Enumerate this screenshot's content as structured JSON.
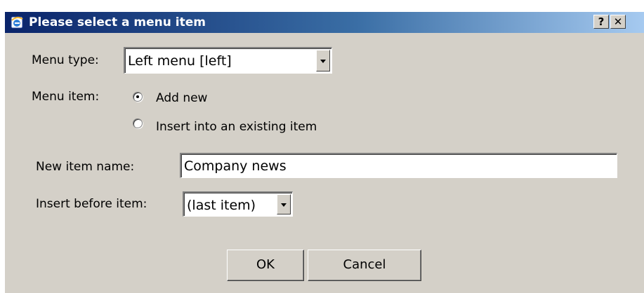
{
  "window": {
    "title": "Please select a menu item",
    "help_label": "?",
    "close_label": "✕",
    "icon": "ie-window-icon"
  },
  "form": {
    "menu_type": {
      "label": "Menu type:",
      "value": "Left menu [left]"
    },
    "menu_item": {
      "label": "Menu item:",
      "options": [
        {
          "label": "Add new",
          "checked": true
        },
        {
          "label": "Insert into an existing item",
          "checked": false
        }
      ]
    },
    "new_item_name": {
      "label": "New item name:",
      "value": "Company news"
    },
    "insert_before": {
      "label": "Insert before item:",
      "value": "(last item)"
    }
  },
  "buttons": {
    "ok": "OK",
    "cancel": "Cancel"
  },
  "colors": {
    "titlebar_start": "#0a246a",
    "titlebar_end": "#a6caf0",
    "face": "#d4d0c8"
  }
}
